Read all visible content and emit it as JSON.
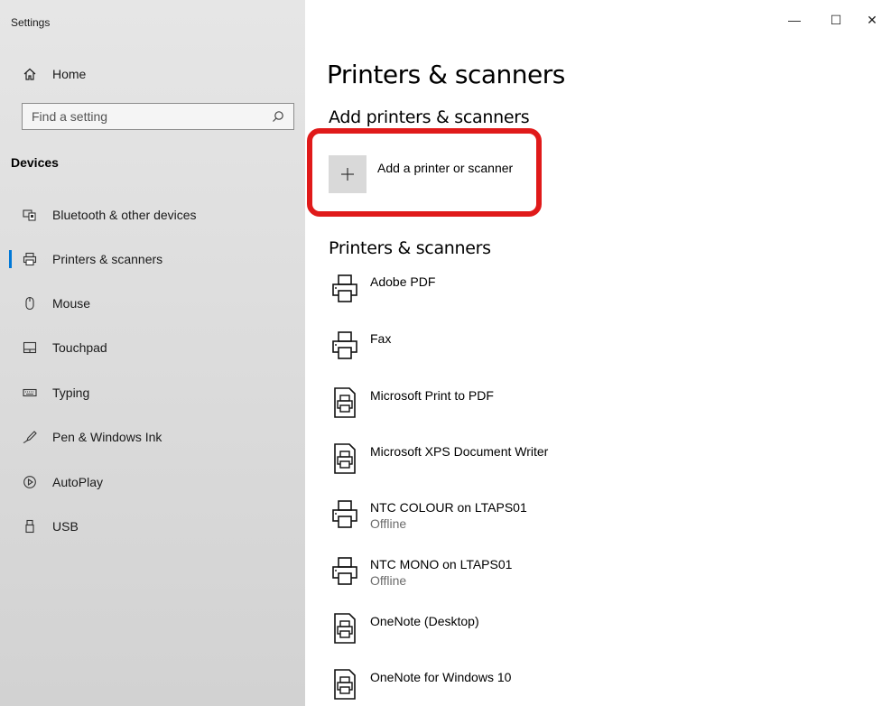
{
  "window": {
    "title": "Settings",
    "minimize_glyph": "—",
    "maximize_glyph": "☐",
    "close_glyph": "✕"
  },
  "sidebar": {
    "home_label": "Home",
    "search_placeholder": "Find a setting",
    "section": "Devices",
    "items": [
      {
        "label": "Bluetooth & other devices",
        "icon": "bluetooth-devices-icon"
      },
      {
        "label": "Printers & scanners",
        "icon": "printer-icon",
        "selected": true
      },
      {
        "label": "Mouse",
        "icon": "mouse-icon"
      },
      {
        "label": "Touchpad",
        "icon": "touchpad-icon"
      },
      {
        "label": "Typing",
        "icon": "keyboard-icon"
      },
      {
        "label": "Pen & Windows Ink",
        "icon": "pen-icon"
      },
      {
        "label": "AutoPlay",
        "icon": "autoplay-icon"
      },
      {
        "label": "USB",
        "icon": "usb-icon"
      }
    ]
  },
  "main": {
    "title": "Printers & scanners",
    "add_heading": "Add printers & scanners",
    "add_button_label": "Add a printer or scanner",
    "list_heading": "Printers & scanners",
    "printers": [
      {
        "name": "Adobe PDF",
        "status": "",
        "icon": "printer-icon"
      },
      {
        "name": "Fax",
        "status": "",
        "icon": "printer-icon"
      },
      {
        "name": "Microsoft Print to PDF",
        "status": "",
        "icon": "document-printer-icon"
      },
      {
        "name": "Microsoft XPS Document Writer",
        "status": "",
        "icon": "document-printer-icon"
      },
      {
        "name": "NTC COLOUR on LTAPS01",
        "status": "Offline",
        "icon": "printer-icon"
      },
      {
        "name": "NTC MONO on LTAPS01",
        "status": "Offline",
        "icon": "printer-icon"
      },
      {
        "name": "OneNote (Desktop)",
        "status": "",
        "icon": "document-printer-icon"
      },
      {
        "name": "OneNote for Windows 10",
        "status": "",
        "icon": "document-printer-icon"
      }
    ]
  },
  "colors": {
    "accent": "#0078d7",
    "highlight_box": "#e01a1a",
    "sidebar_bg": "#dcdcdc"
  }
}
